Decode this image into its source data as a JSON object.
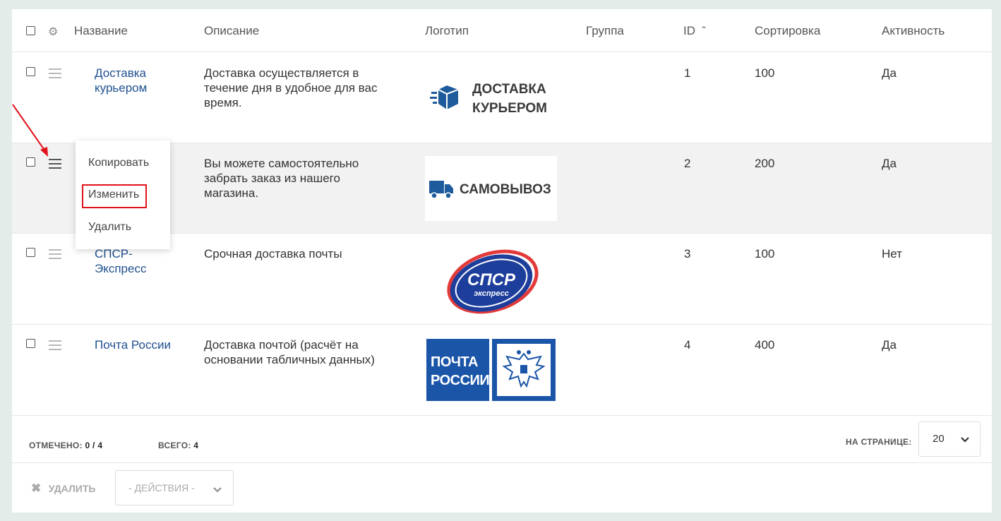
{
  "header": {
    "col_name": "Название",
    "col_desc": "Описание",
    "col_logo": "Логотип",
    "col_group": "Группа",
    "col_id": "ID",
    "col_sort": "Сортировка",
    "col_active": "Активность"
  },
  "rows": [
    {
      "name": "Доставка курьером",
      "name_l1": "Доставка",
      "name_l2": "курьером",
      "desc_l1": "Доставка осуществляется в",
      "desc_l2": "течение дня в удобное для вас",
      "desc_l3": "время.",
      "logo_l1": "ДОСТАВКА",
      "logo_l2": "КУРЬЕРОМ",
      "id": "1",
      "sort": "100",
      "active": "Да"
    },
    {
      "desc_l1": "Вы можете самостоятельно",
      "desc_l2": "забрать заказ из нашего",
      "desc_l3": "магазина.",
      "logo_l1": "САМОВЫВОЗ",
      "id": "2",
      "sort": "200",
      "active": "Да"
    },
    {
      "name_l1": "СПСР-",
      "name_l2": "Экспресс",
      "desc_l1": "Срочная доставка почты",
      "logo_l1": "СПСР",
      "logo_l2": "экспресс",
      "id": "3",
      "sort": "100",
      "active": "Нет"
    },
    {
      "name_l1": "Почта России",
      "desc_l1": "Доставка почтой (расчёт на",
      "desc_l2": "основании табличных данных)",
      "logo_l1": "ПОЧТА",
      "logo_l2": "РОССИИ",
      "id": "4",
      "sort": "400",
      "active": "Да"
    }
  ],
  "menu": {
    "copy": "Копировать",
    "edit": "Изменить",
    "delete": "Удалить"
  },
  "footer": {
    "checked_label": "ОТМЕЧЕНО:",
    "checked_value": "0 / 4",
    "total_label": "ВСЕГО:",
    "total_value": "4",
    "per_page_label": "НА СТРАНИЦЕ:",
    "per_page_value": "20"
  },
  "actions": {
    "delete_label": "УДАЛИТЬ",
    "actions_placeholder": "- ДЕЙСТВИЯ -"
  },
  "colors": {
    "link": "#1f4f8f",
    "highlight": "#e0121b",
    "spsr_blue": "#1e3e9c",
    "pochta_blue": "#1b55a8"
  }
}
